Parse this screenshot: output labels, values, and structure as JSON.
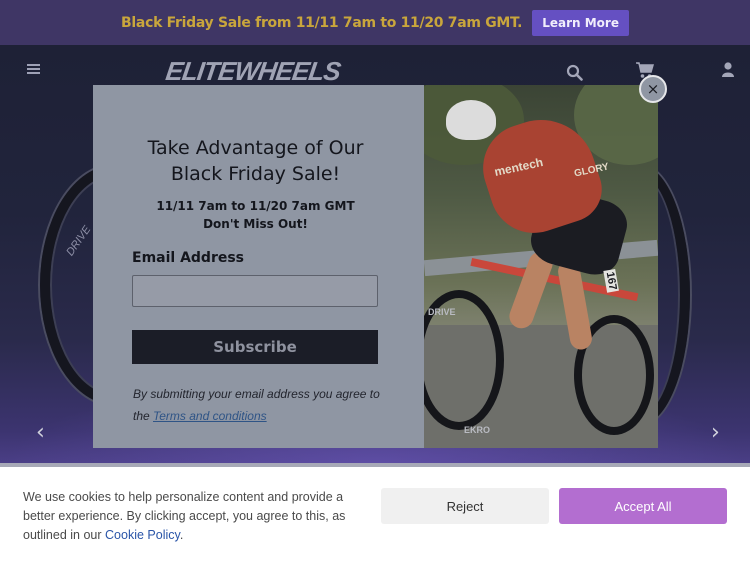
{
  "promo_bar": {
    "text": "Black Friday Sale from 11/11 7am to 11/20 7am GMT.",
    "button_label": "Learn More"
  },
  "header": {
    "logo_text": "ELITEWHEELS",
    "icons": [
      "menu-icon",
      "search-icon",
      "cart-icon",
      "account-icon"
    ]
  },
  "hero": {
    "wheel_brand_text": "DRIVE",
    "prev_arrow": "‹",
    "next_arrow": "›"
  },
  "modal": {
    "title_line1": "Take Advantage of Our",
    "title_line2": "Black Friday Sale!",
    "dates_line1": "11/11 7am to 11/20 7am GMT",
    "dates_line2": "Don't Miss Out!",
    "email_label": "Email Address",
    "email_value": "",
    "email_placeholder": "",
    "subscribe_label": "Subscribe",
    "disclaimer_prefix": "By submitting your email address you agree to the ",
    "terms_link": "Terms and conditions",
    "close_glyph": "×",
    "photo": {
      "jersey_text": "mentech",
      "jersey_text_2": "GLORY",
      "bike_number": "167",
      "wheel_text_1": "DRIVE",
      "wheel_text_2": "EKRO"
    }
  },
  "cookie_banner": {
    "text": "We use cookies to help personalize content and provide a better experience. By clicking accept, you agree to this, as outlined in our ",
    "policy_link": "Cookie Policy",
    "text_suffix": ".",
    "reject_label": "Reject",
    "accept_label": "Accept All"
  },
  "colors": {
    "promo_bg": "#3f3665",
    "promo_text": "#c9a63c",
    "promo_button": "#6550c2",
    "accept_button": "#b36ed0",
    "reject_button": "#f0f0f0",
    "modal_bg": "#8f96a3",
    "subscribe_bg": "#1b1d27"
  }
}
